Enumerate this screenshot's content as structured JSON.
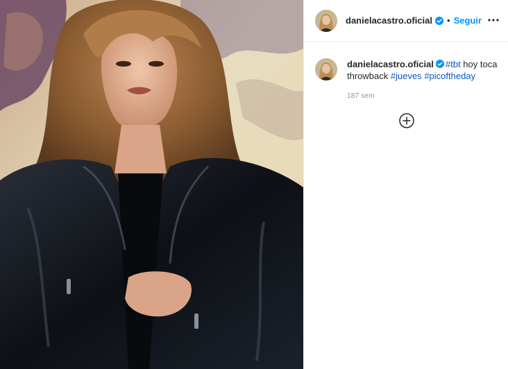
{
  "post": {
    "username": "danielacastro.oficial",
    "verified": true,
    "separator": "•",
    "follow_label": "Seguir",
    "more_icon": "more-horizontal-icon",
    "caption": {
      "username": "danielacastro.oficial",
      "parts": [
        {
          "type": "tag",
          "text": "#tbt"
        },
        {
          "type": "text",
          "text": " hoy toca throwback "
        },
        {
          "type": "tag",
          "text": "#jueves"
        },
        {
          "type": "text",
          "text": " "
        },
        {
          "type": "tag",
          "text": "#picoftheday"
        }
      ],
      "time_ago": "187 sem"
    },
    "load_more_icon": "plus-circle-icon"
  },
  "colors": {
    "accent_blue": "#0095f6",
    "hashtag": "#0a58b8",
    "muted": "#8e8e8e",
    "text": "#262626"
  }
}
